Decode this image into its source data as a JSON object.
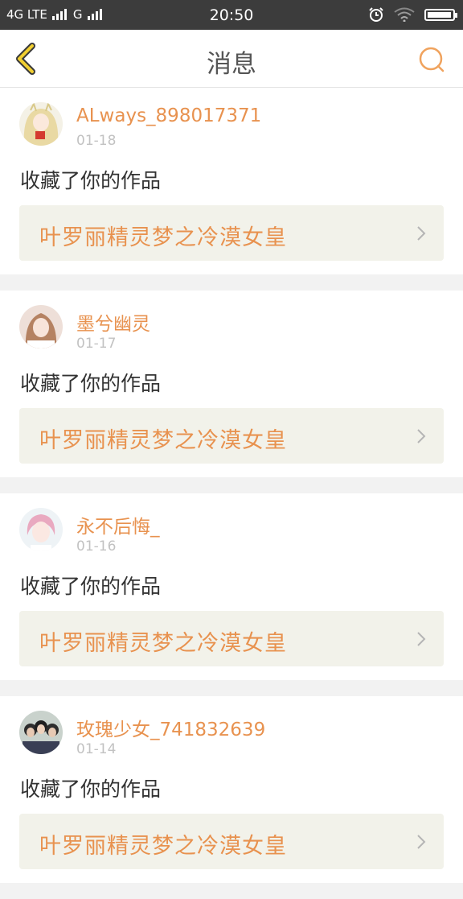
{
  "status_bar": {
    "network1": "4G LTE",
    "network2": "G",
    "time": "20:50",
    "battery_level": 0.95
  },
  "header": {
    "title": "消息",
    "back_icon": "chevron-left-icon",
    "search_icon": "search-icon"
  },
  "colors": {
    "accent": "#e8924f",
    "back_arrow": "#f1cf31",
    "card_bg": "#ffffff",
    "work_bg": "#f2f2ea",
    "page_bg": "#f2f2f2"
  },
  "messages": [
    {
      "username": "ALways_898017371",
      "date": "01-18",
      "action": "收藏了你的作品",
      "work_title": "叶罗丽精灵梦之冷漠女皇",
      "avatar_icon": "anime-girl-avatar"
    },
    {
      "username": "墨兮幽灵",
      "date": "01-17",
      "action": "收藏了你的作品",
      "work_title": "叶罗丽精灵梦之冷漠女皇",
      "avatar_icon": "girl-photo-avatar"
    },
    {
      "username": "永不后悔_",
      "date": "01-16",
      "action": "收藏了你的作品",
      "work_title": "叶罗丽精灵梦之冷漠女皇",
      "avatar_icon": "pink-hair-avatar"
    },
    {
      "username": "玫瑰少女_741832639",
      "date": "01-14",
      "action": "收藏了你的作品",
      "work_title": "叶罗丽精灵梦之冷漠女皇",
      "avatar_icon": "group-photo-avatar"
    }
  ]
}
